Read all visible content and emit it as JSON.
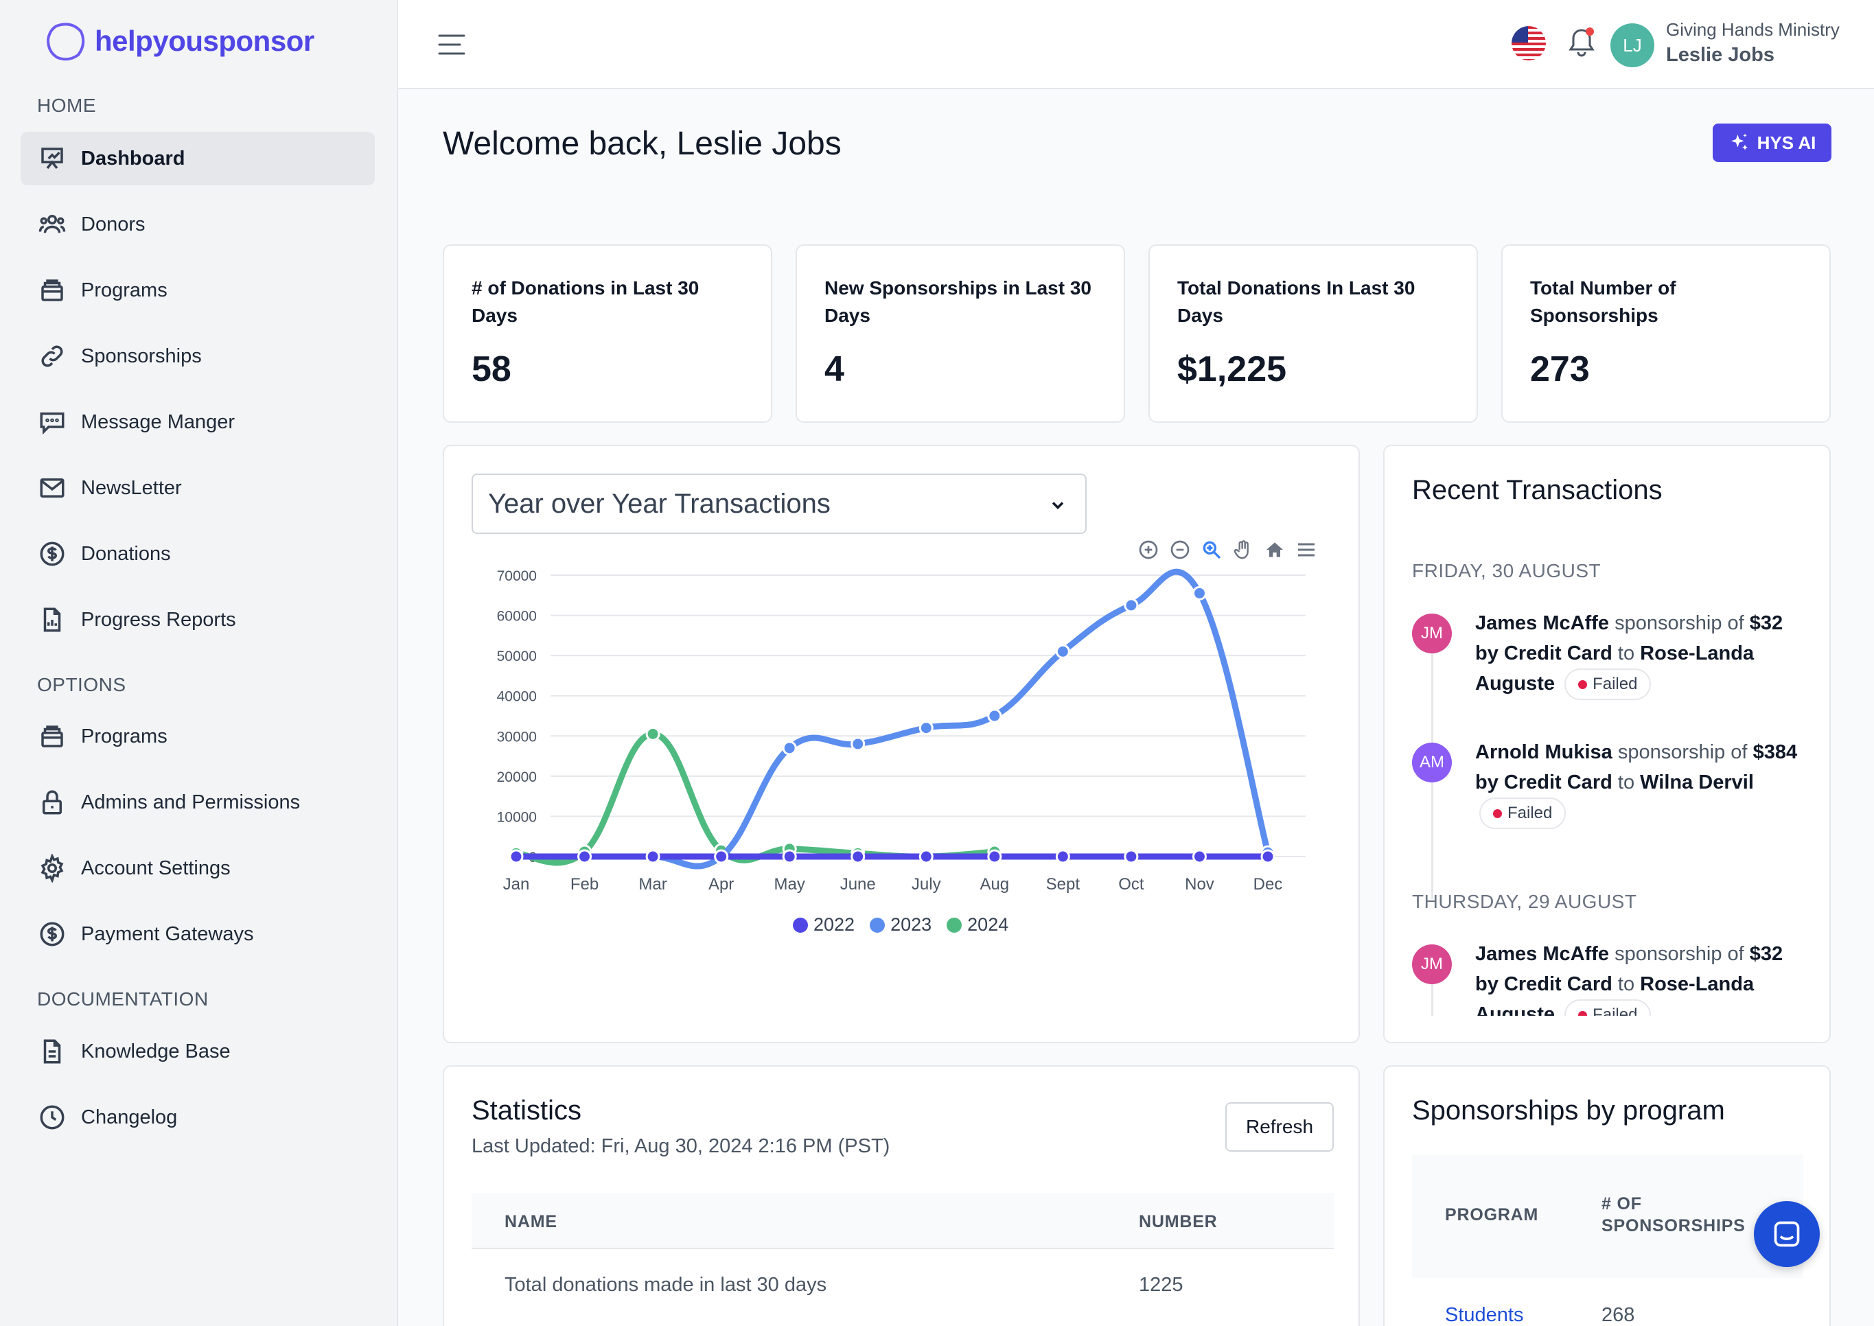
{
  "brand": {
    "name": "helpyousponsor"
  },
  "sidebar": {
    "sections": {
      "home": "HOME",
      "options": "OPTIONS",
      "documentation": "DOCUMENTATION"
    },
    "home_items": [
      {
        "label": "Dashboard",
        "icon": "presentation-chart-icon"
      },
      {
        "label": "Donors",
        "icon": "users-icon"
      },
      {
        "label": "Programs",
        "icon": "archive-box-icon"
      },
      {
        "label": "Sponsorships",
        "icon": "link-icon"
      },
      {
        "label": "Message Manger",
        "icon": "chat-icon"
      },
      {
        "label": "NewsLetter",
        "icon": "envelope-icon"
      },
      {
        "label": "Donations",
        "icon": "dollar-circle-icon"
      },
      {
        "label": "Progress Reports",
        "icon": "report-icon"
      }
    ],
    "option_items": [
      {
        "label": "Programs",
        "icon": "archive-box-icon"
      },
      {
        "label": "Admins and Permissions",
        "icon": "lock-icon"
      },
      {
        "label": "Account Settings",
        "icon": "gear-icon"
      },
      {
        "label": "Payment Gateways",
        "icon": "dollar-circle-icon"
      }
    ],
    "doc_items": [
      {
        "label": "Knowledge Base",
        "icon": "document-icon"
      },
      {
        "label": "Changelog",
        "icon": "clock-icon"
      }
    ]
  },
  "topbar": {
    "org": "Giving Hands Ministry",
    "user": "Leslie Jobs",
    "initials": "LJ"
  },
  "main": {
    "welcome": "Welcome back, Leslie Jobs",
    "ai_button": "HYS AI"
  },
  "stats": [
    {
      "label": "# of Donations in Last 30 Days",
      "value": "58"
    },
    {
      "label": "New Sponsorships in Last 30 Days",
      "value": "4"
    },
    {
      "label": "Total Donations In Last 30 Days",
      "value": "$1,225"
    },
    {
      "label": "Total Number of Sponsorships",
      "value": "273"
    }
  ],
  "chart": {
    "select_value": "Year over Year Transactions"
  },
  "chart_data": {
    "type": "line",
    "categories": [
      "Jan",
      "Feb",
      "Mar",
      "Apr",
      "May",
      "June",
      "July",
      "Aug",
      "Sept",
      "Oct",
      "Nov",
      "Dec"
    ],
    "ylim": [
      0,
      70000
    ],
    "yticks": [
      0,
      10000,
      20000,
      30000,
      40000,
      50000,
      60000,
      70000
    ],
    "series": [
      {
        "name": "2022",
        "color": "#4f46e5",
        "values": [
          0,
          0,
          0,
          0,
          0,
          0,
          0,
          0,
          0,
          0,
          0,
          0
        ]
      },
      {
        "name": "2023",
        "color": "#5b8def",
        "values": [
          0,
          0,
          0,
          0,
          27000,
          28000,
          32000,
          35000,
          51000,
          62500,
          65500,
          1000
        ]
      },
      {
        "name": "2024",
        "color": "#4fba80",
        "values": [
          800,
          1200,
          30500,
          1500,
          1900,
          800,
          0,
          1200,
          null,
          null,
          null,
          null
        ]
      }
    ]
  },
  "recent": {
    "title": "Recent Transactions",
    "groups": [
      {
        "day": "FRIDAY, 30 AUGUST",
        "items": [
          {
            "initials": "JM",
            "color": "#d9478f",
            "name": "James McAffe",
            "w1": "sponsorship of",
            "amount": "$32 by Credit Card",
            "w2": "to",
            "target": "Rose-Landa Auguste",
            "status": "Failed"
          },
          {
            "initials": "AM",
            "color": "#8b5cf6",
            "name": "Arnold Mukisa",
            "w1": "sponsorship of",
            "amount": "$384 by Credit Card",
            "w2": "to",
            "target": "Wilna Dervil",
            "status": "Failed"
          }
        ]
      },
      {
        "day": "THURSDAY, 29 AUGUST",
        "items": [
          {
            "initials": "JM",
            "color": "#d9478f",
            "name": "James McAffe",
            "w1": "sponsorship of",
            "amount": "$32 by Credit Card",
            "w2": "to",
            "target": "Rose-Landa Auguste",
            "status": "Failed"
          }
        ]
      }
    ]
  },
  "statistics": {
    "title": "Statistics",
    "updated": "Last Updated: Fri, Aug 30, 2024 2:16 PM (PST)",
    "refresh": "Refresh",
    "columns": [
      "NAME",
      "NUMBER"
    ],
    "rows": [
      {
        "name": "Total donations made in last 30 days",
        "number": "1225"
      }
    ]
  },
  "by_program": {
    "title": "Sponsorships by program",
    "columns": [
      "PROGRAM",
      "# OF SPONSORSHIPS"
    ],
    "rows": [
      {
        "program": "Students",
        "count": "268"
      }
    ]
  }
}
